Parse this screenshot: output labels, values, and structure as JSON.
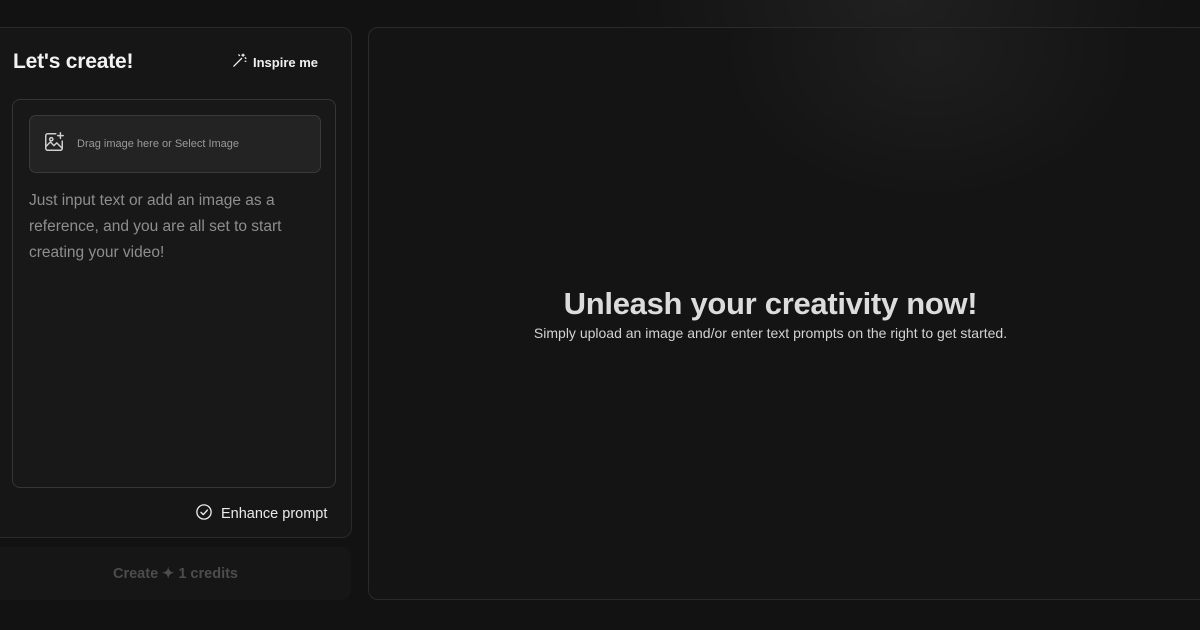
{
  "left_panel": {
    "title": "Let's create!",
    "inspire_label": "Inspire me",
    "inspire_icon": "magic-wand-icon",
    "upload": {
      "icon": "image-add-icon",
      "label": "Drag image here or Select Image"
    },
    "prompt_placeholder": "Just input text or add an image as a reference, and you are all set to start creating your video!",
    "enhance_label": "Enhance prompt",
    "enhance_icon": "check-circle-icon",
    "create_label": "Create ✦ 1 credits"
  },
  "right_panel": {
    "title": "Unleash your creativity now!",
    "subtitle": "Simply upload an image and/or enter text prompts on the right to get started."
  },
  "colors": {
    "background": "#121212",
    "panel": "#161616",
    "upload_zone": "#232323",
    "text_primary": "#f2f2f2",
    "text_muted": "#8e8e8e",
    "create_disabled_text": "#4c4c4c"
  }
}
